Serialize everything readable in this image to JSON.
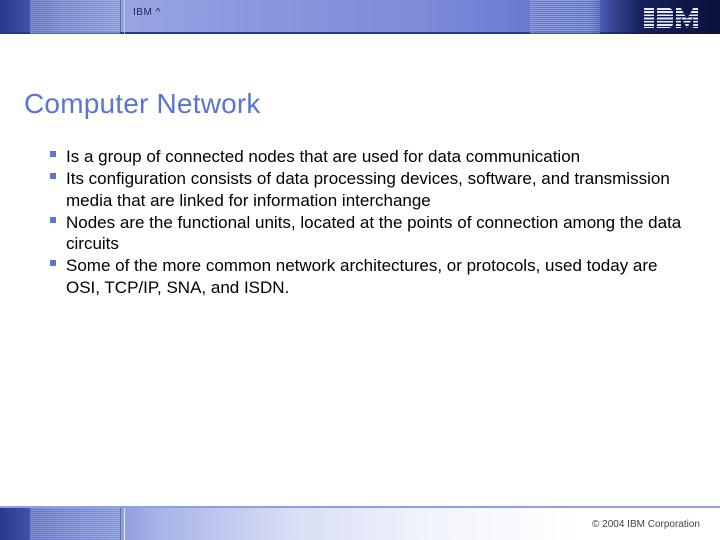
{
  "header": {
    "label": "IBM ^",
    "logo_name": "ibm-logo"
  },
  "title": "Computer Network",
  "bullets": [
    "Is a group of connected nodes that are used for data communication",
    "Its configuration consists of data processing devices, software, and transmission media that are linked for information interchange",
    "Nodes are the functional units, located at the points of connection among the data circuits",
    "Some of the more common network architectures, or protocols, used today are OSI, TCP/IP, SNA, and ISDN."
  ],
  "footer": {
    "copyright": "© 2004 IBM Corporation"
  },
  "colors": {
    "accent": "#5a75d4",
    "band_dark": "#2a3a8a"
  }
}
